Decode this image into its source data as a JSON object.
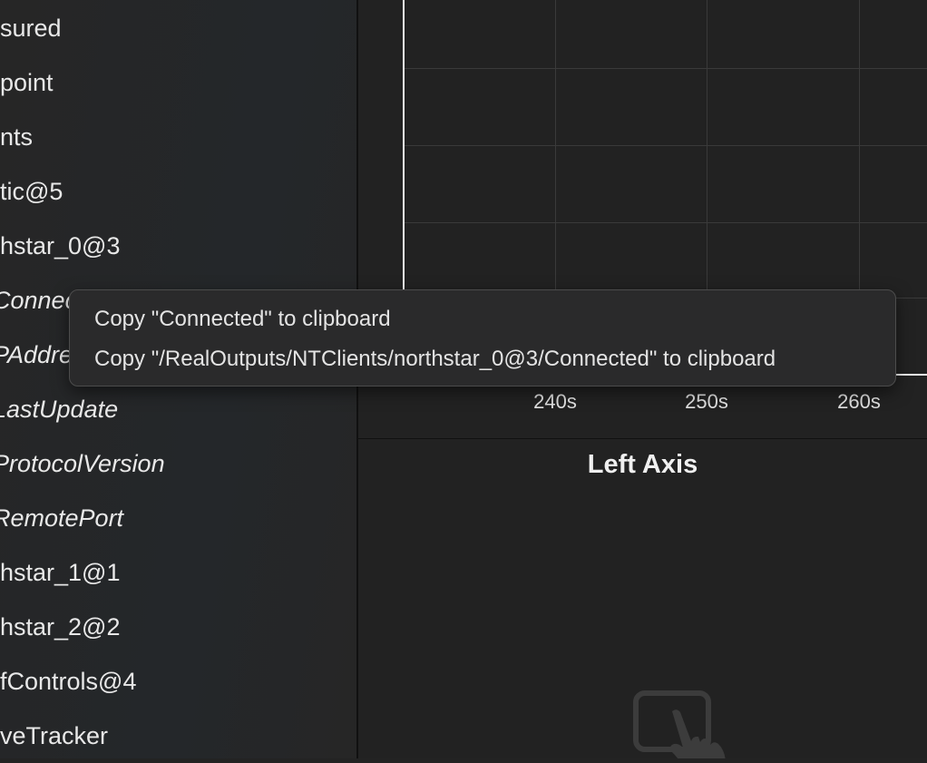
{
  "sidebar": {
    "items": [
      {
        "label": "sured",
        "italic": false
      },
      {
        "label": "point",
        "italic": false
      },
      {
        "label": "nts",
        "italic": false
      },
      {
        "label": "tic@5",
        "italic": false
      },
      {
        "label": "hstar_0@3",
        "italic": false
      },
      {
        "label": "Connected",
        "italic": true
      },
      {
        "label": "PAddress",
        "italic": true
      },
      {
        "label": "LastUpdate",
        "italic": true
      },
      {
        "label": "ProtocolVersion",
        "italic": true
      },
      {
        "label": "RemotePort",
        "italic": true
      },
      {
        "label": "hstar_1@1",
        "italic": false
      },
      {
        "label": "hstar_2@2",
        "italic": false
      },
      {
        "label": "fControls@4",
        "italic": false
      },
      {
        "label": "veTracker",
        "italic": false
      }
    ]
  },
  "chart": {
    "x_ticks": [
      "240s",
      "250s",
      "260s"
    ]
  },
  "left_axis": {
    "title": "Left Axis",
    "icon": "hand-tap-trackpad-icon"
  },
  "context_menu": {
    "items": [
      "Copy \"Connected\" to clipboard",
      "Copy \"/RealOutputs/NTClients/northstar_0@3/Connected\" to clipboard"
    ]
  }
}
